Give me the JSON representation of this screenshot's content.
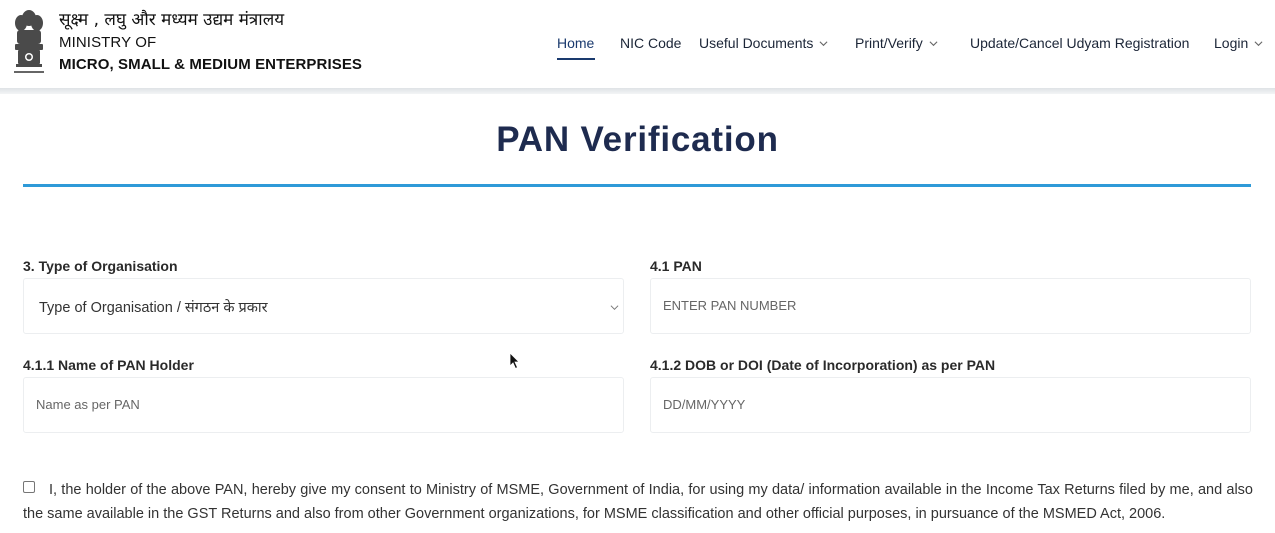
{
  "header": {
    "brand": {
      "hindi": "सूक्ष्म , लघु और मध्यम उद्यम मंत्रालय",
      "ministry": "MINISTRY OF",
      "name": "MICRO, SMALL & MEDIUM ENTERPRISES",
      "emblem_icon": "ashoka-emblem-icon",
      "emblem_caption": "सत्यमेव जयते"
    },
    "nav": [
      {
        "label": "Home",
        "active": true,
        "dropdown": false
      },
      {
        "label": "NIC Code",
        "active": false,
        "dropdown": false
      },
      {
        "label": "Useful Documents",
        "active": false,
        "dropdown": true
      },
      {
        "label": "Print/Verify",
        "active": false,
        "dropdown": true
      },
      {
        "label": "Update/Cancel Udyam Registration",
        "active": false,
        "dropdown": false
      },
      {
        "label": "Login",
        "active": false,
        "dropdown": true
      }
    ]
  },
  "page": {
    "title": "PAN Verification"
  },
  "form": {
    "org_type": {
      "label": "3. Type of Organisation",
      "selected": "Type of Organisation / संगठन के प्रकार"
    },
    "pan": {
      "label": "4.1 PAN",
      "placeholder": "ENTER PAN NUMBER"
    },
    "pan_name": {
      "label": "4.1.1 Name of PAN Holder",
      "placeholder": "Name as per PAN"
    },
    "dob": {
      "label": "4.1.2 DOB or DOI (Date of Incorporation) as per PAN",
      "placeholder": "DD/MM/YYYY"
    },
    "consent": {
      "checked": false,
      "text": "I, the holder of the above PAN, hereby give my consent to Ministry of MSME, Government of India, for using my data/ information available in the Income Tax Returns filed by me, and also the same available in the GST Returns and also from other Government organizations, for MSME classification and other official purposes, in pursuance of the MSMED Act, 2006."
    }
  },
  "colors": {
    "nav_active": "#1a3a6e",
    "title": "#1e2b4f",
    "title_rule": "#2e9ad8"
  }
}
